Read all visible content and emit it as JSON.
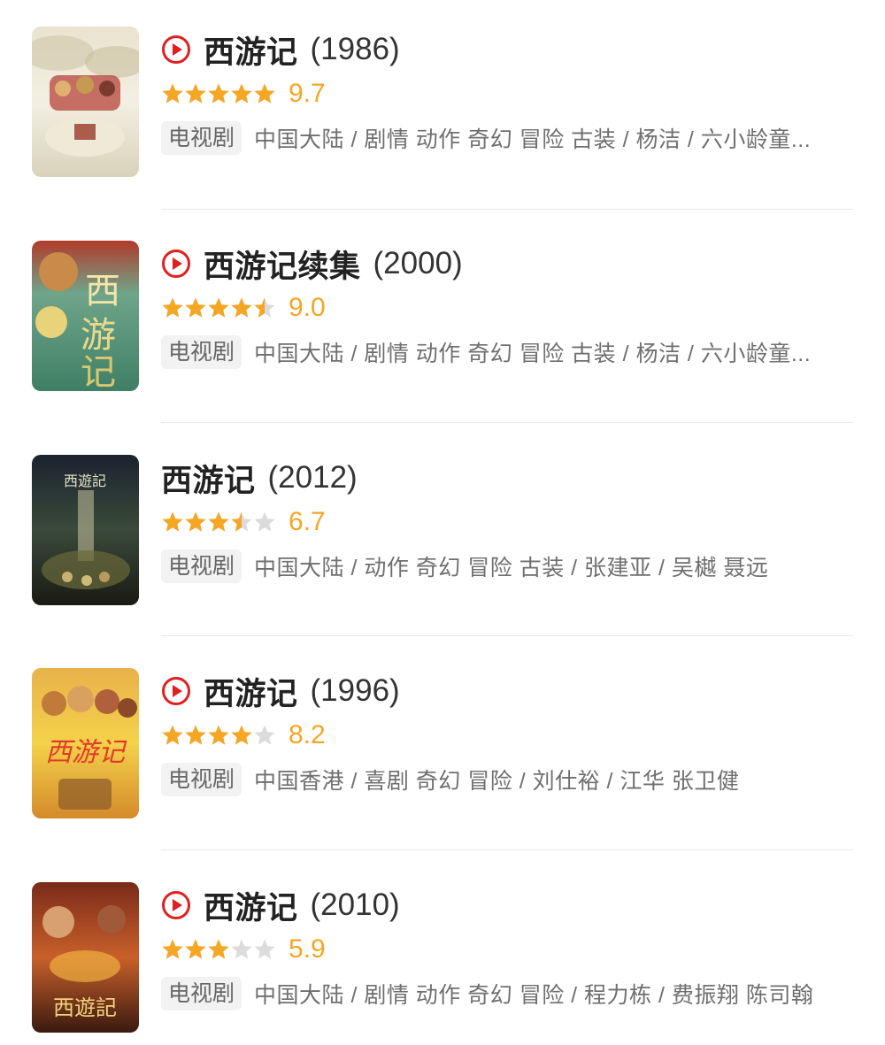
{
  "accent": "#e02020",
  "star_color": "#f5a623",
  "items": [
    {
      "title": "西游记",
      "year": "(1986)",
      "playable": true,
      "rating_value": 9.7,
      "stars_out_of_5": 5,
      "score": "9.7",
      "tag": "电视剧",
      "meta": "中国大陆 / 剧情 动作 奇幻 冒险 古装 / 杨洁 / 六小龄童...",
      "poster_theme": "classic-clouds"
    },
    {
      "title": "西游记续集",
      "year": "(2000)",
      "playable": true,
      "rating_value": 9.0,
      "stars_out_of_5": 4.5,
      "score": "9.0",
      "tag": "电视剧",
      "meta": "中国大陆 / 剧情 动作 奇幻 冒险 古装 / 杨洁 / 六小龄童...",
      "poster_theme": "sequel-green"
    },
    {
      "title": "西游记",
      "year": "(2012)",
      "playable": false,
      "rating_value": 6.7,
      "stars_out_of_5": 3.5,
      "score": "6.7",
      "tag": "电视剧",
      "meta": "中国大陆 / 动作 奇幻 冒险 古装 / 张建亚 / 吴樾 聂远",
      "poster_theme": "dark-waterfall"
    },
    {
      "title": "西游记",
      "year": "(1996)",
      "playable": true,
      "rating_value": 8.2,
      "stars_out_of_5": 4,
      "score": "8.2",
      "tag": "电视剧",
      "meta": "中国香港 / 喜剧 奇幻 冒险 / 刘仕裕 / 江华 张卫健",
      "poster_theme": "yellow-sky"
    },
    {
      "title": "西游记",
      "year": "(2010)",
      "playable": true,
      "rating_value": 5.9,
      "stars_out_of_5": 3,
      "score": "5.9",
      "tag": "电视剧",
      "meta": "中国大陆 / 剧情 动作 奇幻 冒险 / 程力栋 / 费振翔 陈司翰",
      "poster_theme": "red-fire"
    }
  ]
}
